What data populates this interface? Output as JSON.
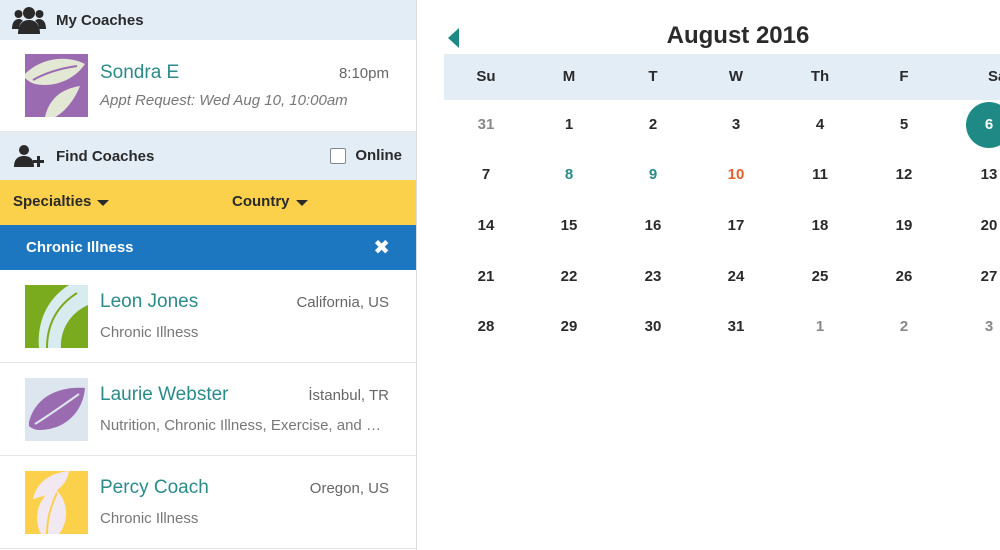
{
  "my_coaches": {
    "title": "My Coaches",
    "icon": "users-icon",
    "appointment": {
      "name": "Sondra E",
      "time": "8:10pm",
      "request": "Appt Request: Wed Aug 10, 10:00am",
      "avatar_color": "#9a6bb0"
    }
  },
  "find_coaches": {
    "title": "Find Coaches",
    "icon": "add-user-icon",
    "online_label": "Online",
    "online_checked": false
  },
  "filters": {
    "specialties_label": "Specialties",
    "country_label": "Country",
    "bar_color": "#fbd14b"
  },
  "active_tag": {
    "label": "Chronic Illness",
    "close_symbol": "✖",
    "color": "#1c77c0"
  },
  "coaches": [
    {
      "name": "Leon Jones",
      "location": "California, US",
      "specialties": "Chronic Illness",
      "avatar_color": "#7aab1e"
    },
    {
      "name": "Laurie Webster",
      "location": "İstanbul, TR",
      "specialties": "Nutrition, Chronic Illness, Exercise, and more",
      "avatar_color": "#dde6ef"
    },
    {
      "name": "Percy Coach",
      "location": "Oregon, US",
      "specialties": "Chronic Illness",
      "avatar_color": "#fbd14b"
    }
  ],
  "calendar": {
    "month_title": "August 2016",
    "accent_color": "#1f8a85",
    "weekdays": [
      "Su",
      "M",
      "T",
      "W",
      "Th",
      "F",
      "Sa"
    ],
    "weeks": [
      [
        "31",
        "1",
        "2",
        "3",
        "4",
        "5",
        "6"
      ],
      [
        "7",
        "8",
        "9",
        "10",
        "11",
        "12",
        "13"
      ],
      [
        "14",
        "15",
        "16",
        "17",
        "18",
        "19",
        "20"
      ],
      [
        "21",
        "22",
        "23",
        "24",
        "25",
        "26",
        "27"
      ],
      [
        "28",
        "29",
        "30",
        "31",
        "1",
        "2",
        "3"
      ]
    ],
    "muted_days": [
      "0-0",
      "4-4",
      "4-5",
      "4-6"
    ],
    "teal_days": [
      "1-1",
      "1-2"
    ],
    "orange_days": [
      "1-3"
    ],
    "selected_day": "0-6"
  }
}
